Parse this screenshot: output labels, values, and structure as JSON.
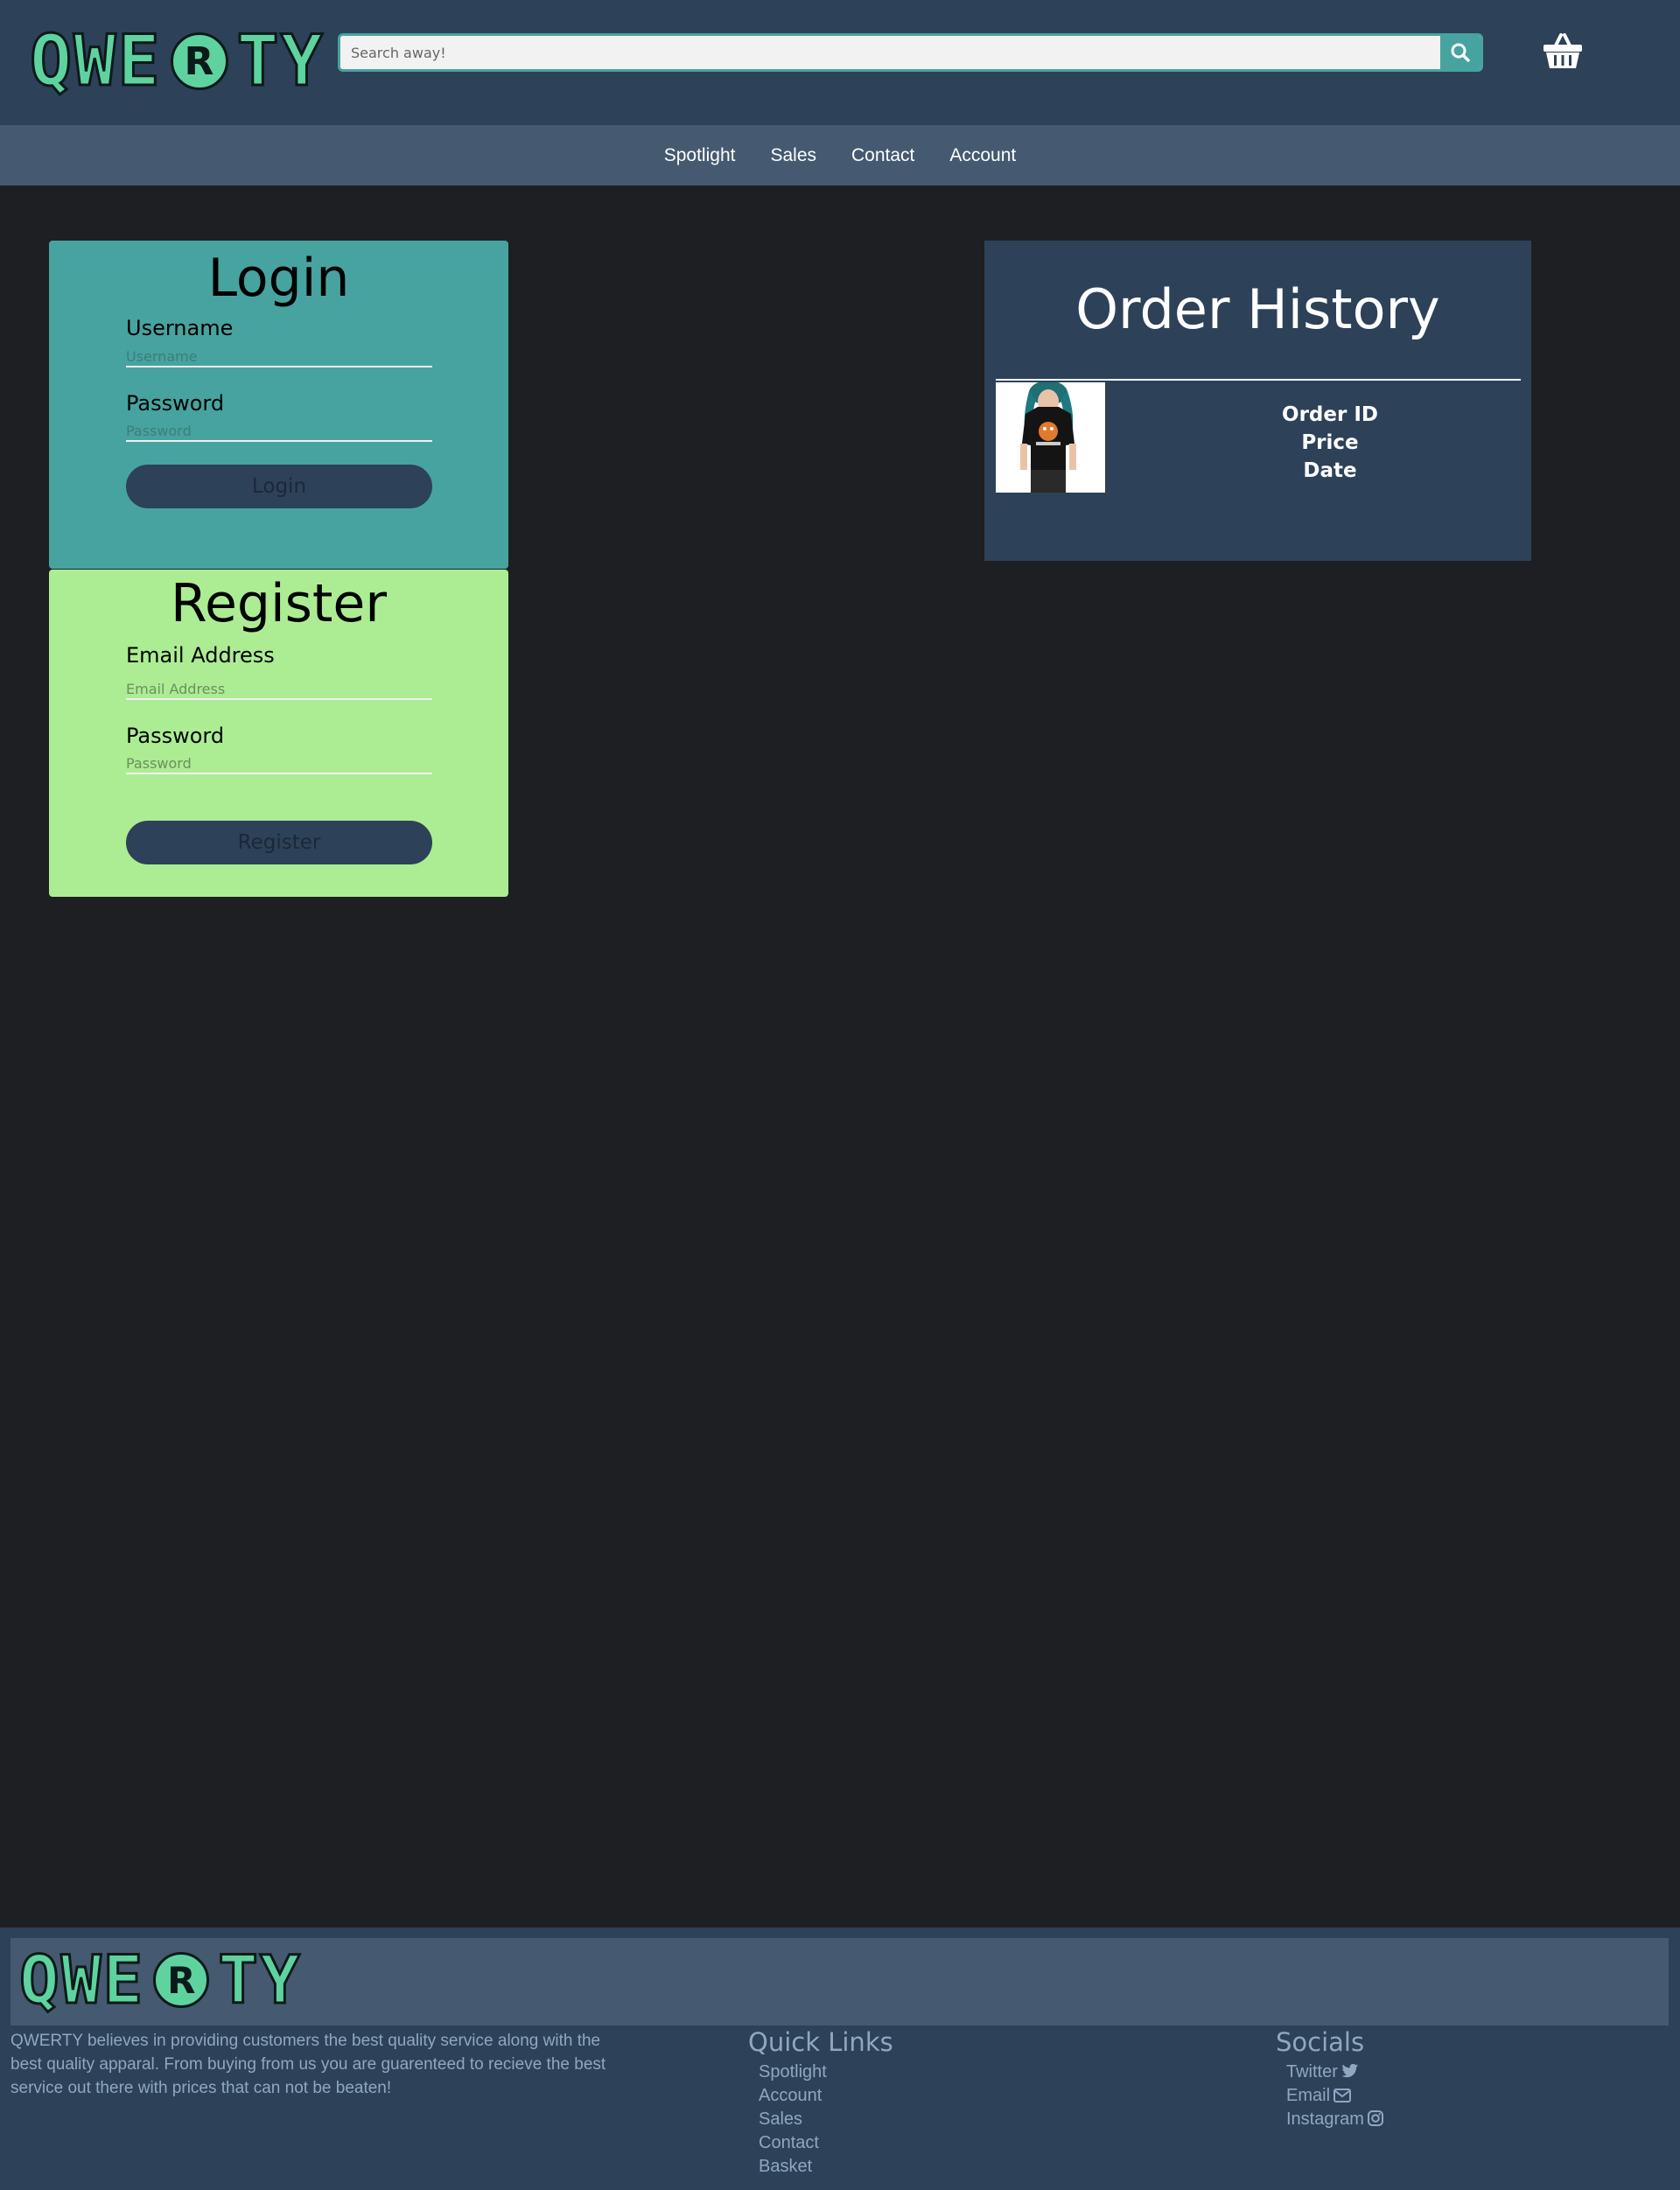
{
  "header": {
    "logo_text_left": "QWE",
    "logo_reg": "R",
    "logo_text_right": "TY",
    "search_placeholder": "Search away!",
    "search_icon": "search-icon",
    "basket_icon": "basket-icon"
  },
  "nav": {
    "items": [
      {
        "label": "Spotlight"
      },
      {
        "label": "Sales"
      },
      {
        "label": "Contact"
      },
      {
        "label": "Account"
      }
    ]
  },
  "login": {
    "title": "Login",
    "username_label": "Username",
    "username_placeholder": "Username",
    "password_label": "Password",
    "password_placeholder": "Password",
    "button_label": "Login"
  },
  "register": {
    "title": "Register",
    "email_label": "Email Address",
    "email_placeholder": "Email Address",
    "password_label": "Password",
    "password_placeholder": "Password",
    "button_label": "Register"
  },
  "orders": {
    "title": "Order History",
    "entry": {
      "id_label": "Order ID",
      "price_label": "Price",
      "date_label": "Date"
    }
  },
  "footer": {
    "logo_text_left": "QWE",
    "logo_reg": "R",
    "logo_text_right": "TY",
    "about": "QWERTY believes in providing customers the best quality service along with the best quality apparal. From buying from us you are guarenteed to recieve the best service out there with prices that can not be beaten!",
    "quick_links_title": "Quick Links",
    "quick_links": [
      "Spotlight",
      "Account",
      "Sales",
      "Contact",
      "Basket"
    ],
    "socials_title": "Socials",
    "socials": [
      {
        "label": "Twitter",
        "icon": "twitter-icon"
      },
      {
        "label": "Email",
        "icon": "envelope-icon"
      },
      {
        "label": "Instagram",
        "icon": "instagram-icon"
      }
    ]
  },
  "colors": {
    "header_bg": "#2d4159",
    "nav_bg": "#455a70",
    "page_bg": "#1e1f23",
    "login_bg": "#47a39f",
    "register_bg": "#aced93",
    "logo_green": "#5ed3a0"
  }
}
